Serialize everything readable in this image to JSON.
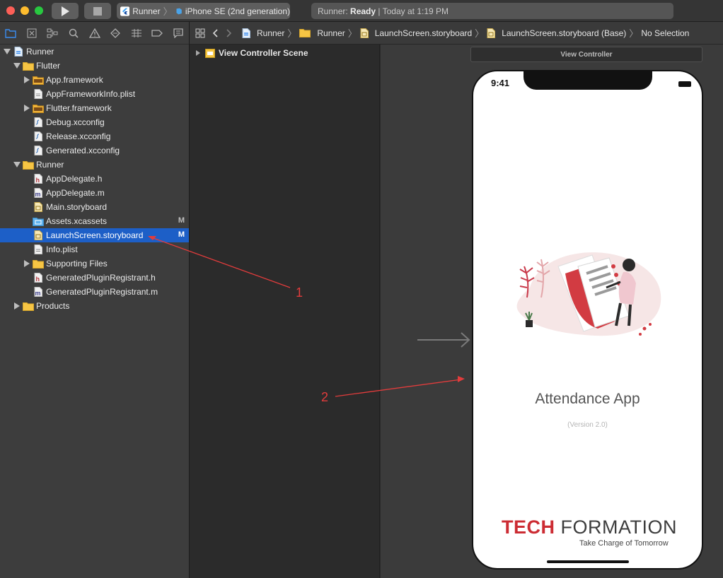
{
  "toolbar": {
    "scheme_app": "Runner",
    "scheme_device": "iPhone SE (2nd generation)",
    "status_prefix": "Runner: ",
    "status_bold": "Ready",
    "status_suffix": " | Today at 1:19 PM"
  },
  "navigator": {
    "tabs": [
      "folder-icon",
      "source-control-icon",
      "symbol-icon",
      "search-icon",
      "warning-icon",
      "test-icon",
      "debug-icon",
      "breakpoint-icon",
      "report-icon"
    ],
    "tree": [
      {
        "label": "Runner",
        "depth": 0,
        "disclosure": "open",
        "icon": "project",
        "badge": ""
      },
      {
        "label": "Flutter",
        "depth": 1,
        "disclosure": "open",
        "icon": "folder",
        "badge": ""
      },
      {
        "label": "App.framework",
        "depth": 2,
        "disclosure": "closed",
        "icon": "framework",
        "badge": ""
      },
      {
        "label": "AppFrameworkInfo.plist",
        "depth": 2,
        "disclosure": "none",
        "icon": "file",
        "badge": ""
      },
      {
        "label": "Flutter.framework",
        "depth": 2,
        "disclosure": "closed",
        "icon": "framework",
        "badge": ""
      },
      {
        "label": "Debug.xcconfig",
        "depth": 2,
        "disclosure": "none",
        "icon": "config",
        "badge": ""
      },
      {
        "label": "Release.xcconfig",
        "depth": 2,
        "disclosure": "none",
        "icon": "config",
        "badge": ""
      },
      {
        "label": "Generated.xcconfig",
        "depth": 2,
        "disclosure": "none",
        "icon": "config",
        "badge": ""
      },
      {
        "label": "Runner",
        "depth": 1,
        "disclosure": "open",
        "icon": "folder",
        "badge": ""
      },
      {
        "label": "AppDelegate.h",
        "depth": 2,
        "disclosure": "none",
        "icon": "header",
        "badge": ""
      },
      {
        "label": "AppDelegate.m",
        "depth": 2,
        "disclosure": "none",
        "icon": "impl",
        "badge": ""
      },
      {
        "label": "Main.storyboard",
        "depth": 2,
        "disclosure": "none",
        "icon": "storyboard",
        "badge": ""
      },
      {
        "label": "Assets.xcassets",
        "depth": 2,
        "disclosure": "none",
        "icon": "assets",
        "badge": "M"
      },
      {
        "label": "LaunchScreen.storyboard",
        "depth": 2,
        "disclosure": "none",
        "icon": "storyboard",
        "badge": "M",
        "selected": true
      },
      {
        "label": "Info.plist",
        "depth": 2,
        "disclosure": "none",
        "icon": "file",
        "badge": ""
      },
      {
        "label": "Supporting Files",
        "depth": 2,
        "disclosure": "closed",
        "icon": "folder",
        "badge": ""
      },
      {
        "label": "GeneratedPluginRegistrant.h",
        "depth": 2,
        "disclosure": "none",
        "icon": "header",
        "badge": ""
      },
      {
        "label": "GeneratedPluginRegistrant.m",
        "depth": 2,
        "disclosure": "none",
        "icon": "impl",
        "badge": ""
      },
      {
        "label": "Products",
        "depth": 1,
        "disclosure": "closed",
        "icon": "folder",
        "badge": ""
      }
    ]
  },
  "jumpbar": {
    "crumbs": [
      {
        "label": "Runner",
        "icon": "project"
      },
      {
        "label": "Runner",
        "icon": "folder"
      },
      {
        "label": "LaunchScreen.storyboard",
        "icon": "storyboard"
      },
      {
        "label": "LaunchScreen.storyboard (Base)",
        "icon": "storyboard"
      },
      {
        "label": "No Selection",
        "icon": ""
      }
    ]
  },
  "outline": {
    "scene": "View Controller Scene"
  },
  "canvas": {
    "vc_header": "View Controller",
    "phone": {
      "time": "9:41",
      "title": "Attendance App",
      "version": "(Version 2.0)",
      "logo_left": "TECH",
      "logo_right": "FORMATION",
      "tagline": "Take Charge of Tomorrow"
    }
  },
  "annotations": {
    "one": "1",
    "two": "2"
  },
  "colors": {
    "selection": "#1d5fc7",
    "annotation": "#e23c3c",
    "brand_red": "#cc2c33"
  }
}
